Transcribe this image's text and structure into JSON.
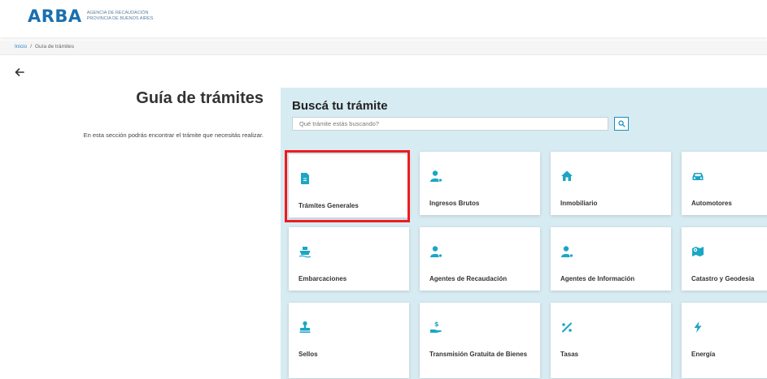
{
  "header": {
    "logo_word": "ARBA",
    "logo_line1": "AGENCIA DE RECAUDACIÓN",
    "logo_line2": "PROVINCIA DE BUENOS AIRES"
  },
  "breadcrumb": {
    "home": "Inicio",
    "separator": "/",
    "current": "Guía de trámites"
  },
  "intro": {
    "title": "Guía de trámites",
    "text": "En esta sección podrás encontrar el trámite que necesitás realizar."
  },
  "search": {
    "title": "Buscá tu trámite",
    "placeholder": "Qué trámite estás buscando?"
  },
  "colors": {
    "brand": "#1a6fb0",
    "panel_bg": "#d7ebf2",
    "icon": "#1ba6c4",
    "highlight": "#ee1c1c"
  },
  "cards": [
    {
      "label": "Trámites Generales",
      "icon": "document-icon"
    },
    {
      "label": "Ingresos Brutos",
      "icon": "user-money-icon"
    },
    {
      "label": "Inmobiliario",
      "icon": "house-icon"
    },
    {
      "label": "Automotores",
      "icon": "car-icon"
    },
    {
      "label": "Embarcaciones",
      "icon": "ship-icon"
    },
    {
      "label": "Agentes de Recaudación",
      "icon": "user-money-icon"
    },
    {
      "label": "Agentes de Información",
      "icon": "user-info-icon"
    },
    {
      "label": "Catastro y Geodesia",
      "icon": "map-icon"
    },
    {
      "label": "Sellos",
      "icon": "stamp-icon"
    },
    {
      "label": "Transmisión Gratuita de Bienes",
      "icon": "hand-money-icon"
    },
    {
      "label": "Tasas",
      "icon": "percent-icon"
    },
    {
      "label": "Energía",
      "icon": "lightning-icon"
    }
  ]
}
